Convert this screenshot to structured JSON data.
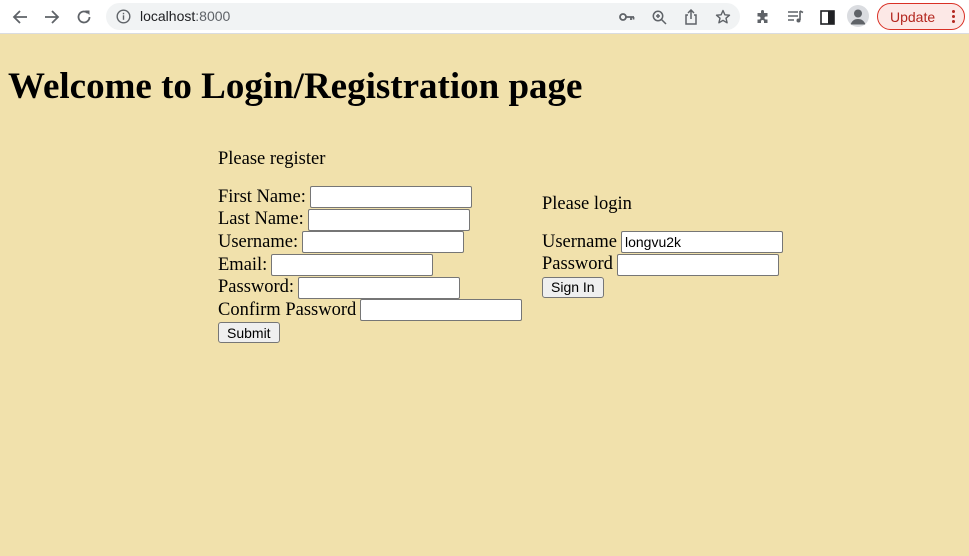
{
  "browser": {
    "url_host": "localhost",
    "url_port": ":8000",
    "update_label": "Update",
    "icons": [
      "back-icon",
      "forward-icon",
      "reload-icon",
      "site-info-icon",
      "key-icon",
      "zoom-icon",
      "share-icon",
      "star-icon",
      "extensions-icon",
      "media-icon",
      "side-panel-icon",
      "profile-icon",
      "more-icon"
    ]
  },
  "page": {
    "title": "Welcome to Login/Registration page",
    "background": "#f1e1ac"
  },
  "register": {
    "heading": "Please register",
    "first_name_label": "First Name:",
    "last_name_label": "Last Name:",
    "username_label": "Username:",
    "email_label": "Email:",
    "password_label": "Password:",
    "confirm_password_label": "Confirm Password",
    "submit_label": "Submit"
  },
  "login": {
    "heading": "Please login",
    "username_label": "Username",
    "username_value": "longvu2k",
    "password_label": "Password",
    "sign_in_label": "Sign In"
  }
}
